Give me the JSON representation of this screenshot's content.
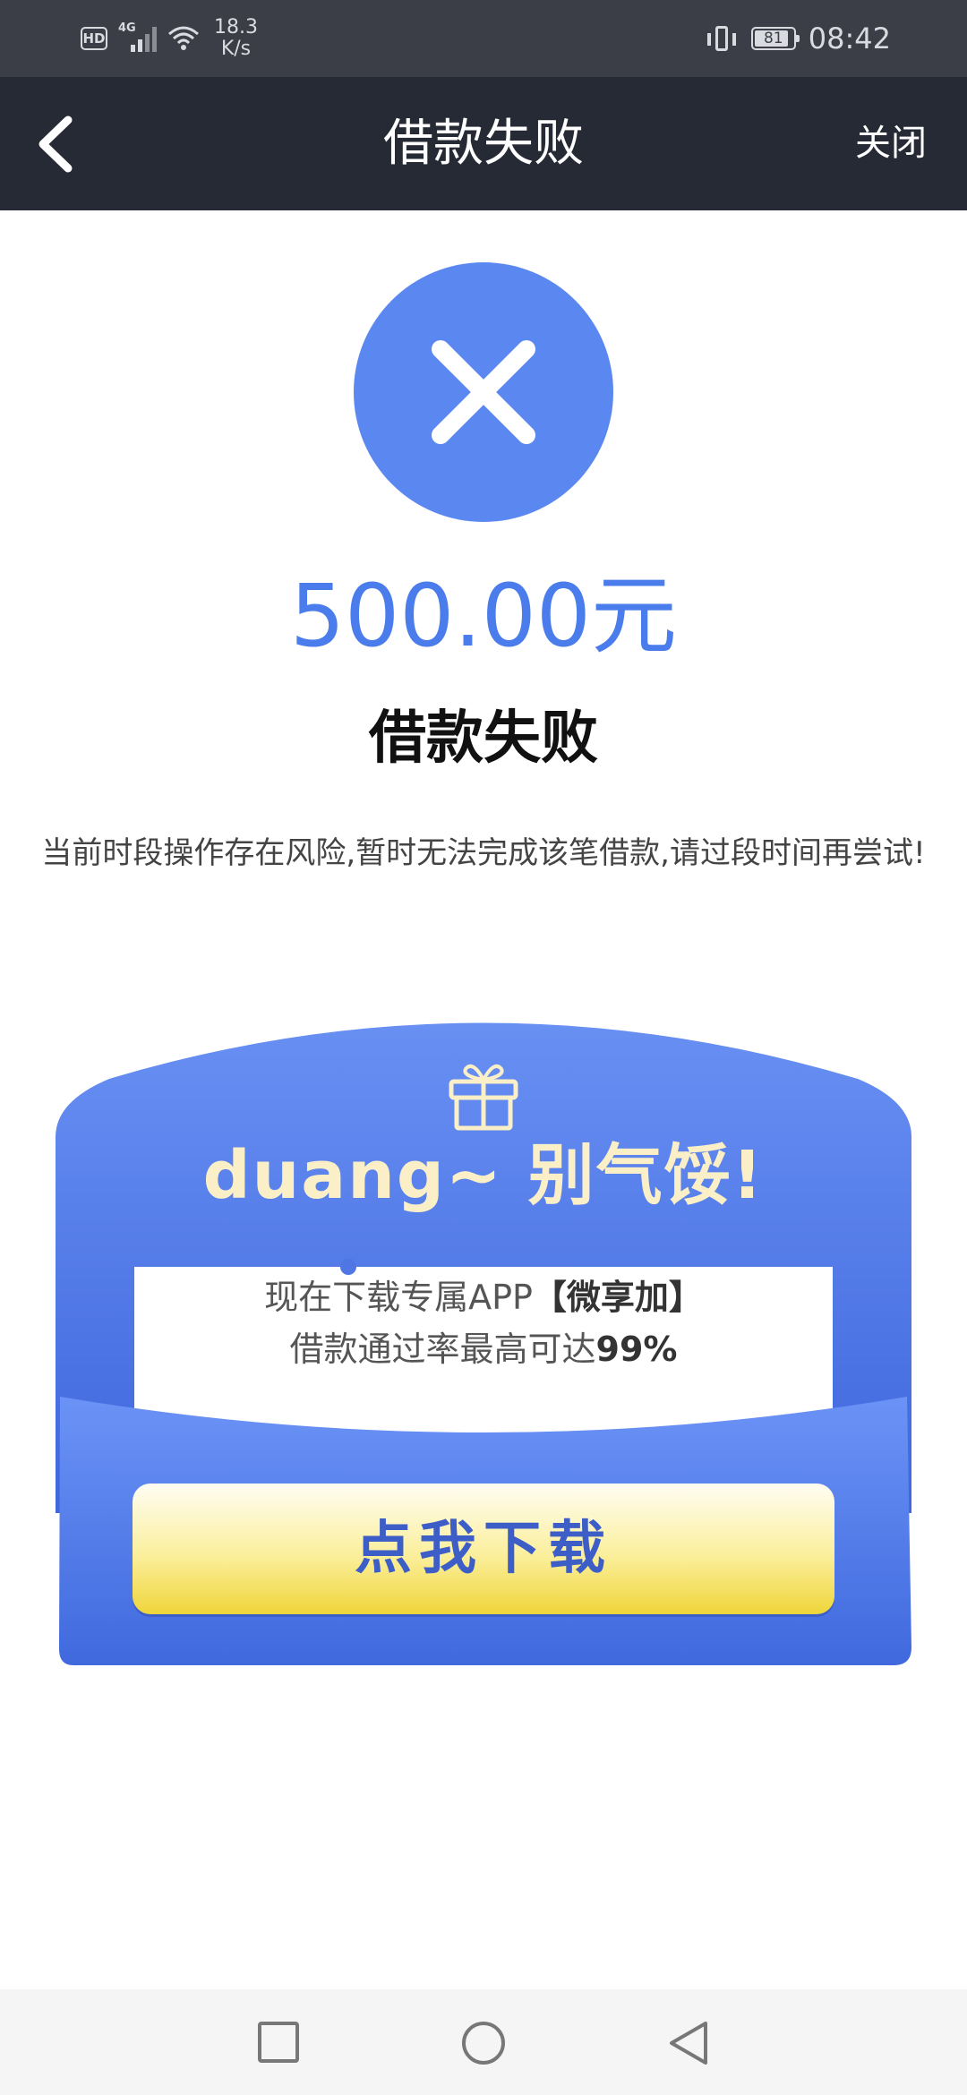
{
  "status_bar": {
    "hd": "HD",
    "network": "4G",
    "speed_value": "18.3",
    "speed_unit": "K/s",
    "battery": "81",
    "time": "08:42"
  },
  "nav": {
    "title": "借款失败",
    "close_label": "关闭"
  },
  "result": {
    "amount": "500.00元",
    "title": "借款失败",
    "message": "当前时段操作存在风险,暂时无法完成该笔借款,请过段时间再尝试!"
  },
  "promo": {
    "title": "duang~ 别气馁!",
    "line1_prefix": "现在下载专属APP",
    "line1_app": "【微享加】",
    "line2_prefix": "借款通过率最高可达",
    "line2_rate": "99%",
    "button_label": "点我下载"
  },
  "colors": {
    "accent": "#5b88f0",
    "navbar": "#262a35",
    "statusbar": "#3b3e46",
    "promo_blue": "#4a72e6",
    "button_yellow": "#efd53a"
  },
  "icons": {
    "back": "chevron-left-icon",
    "fail": "x-circle-icon",
    "gift": "gift-icon",
    "recents": "square-icon",
    "home": "circle-icon",
    "back_nav": "triangle-back-icon"
  }
}
